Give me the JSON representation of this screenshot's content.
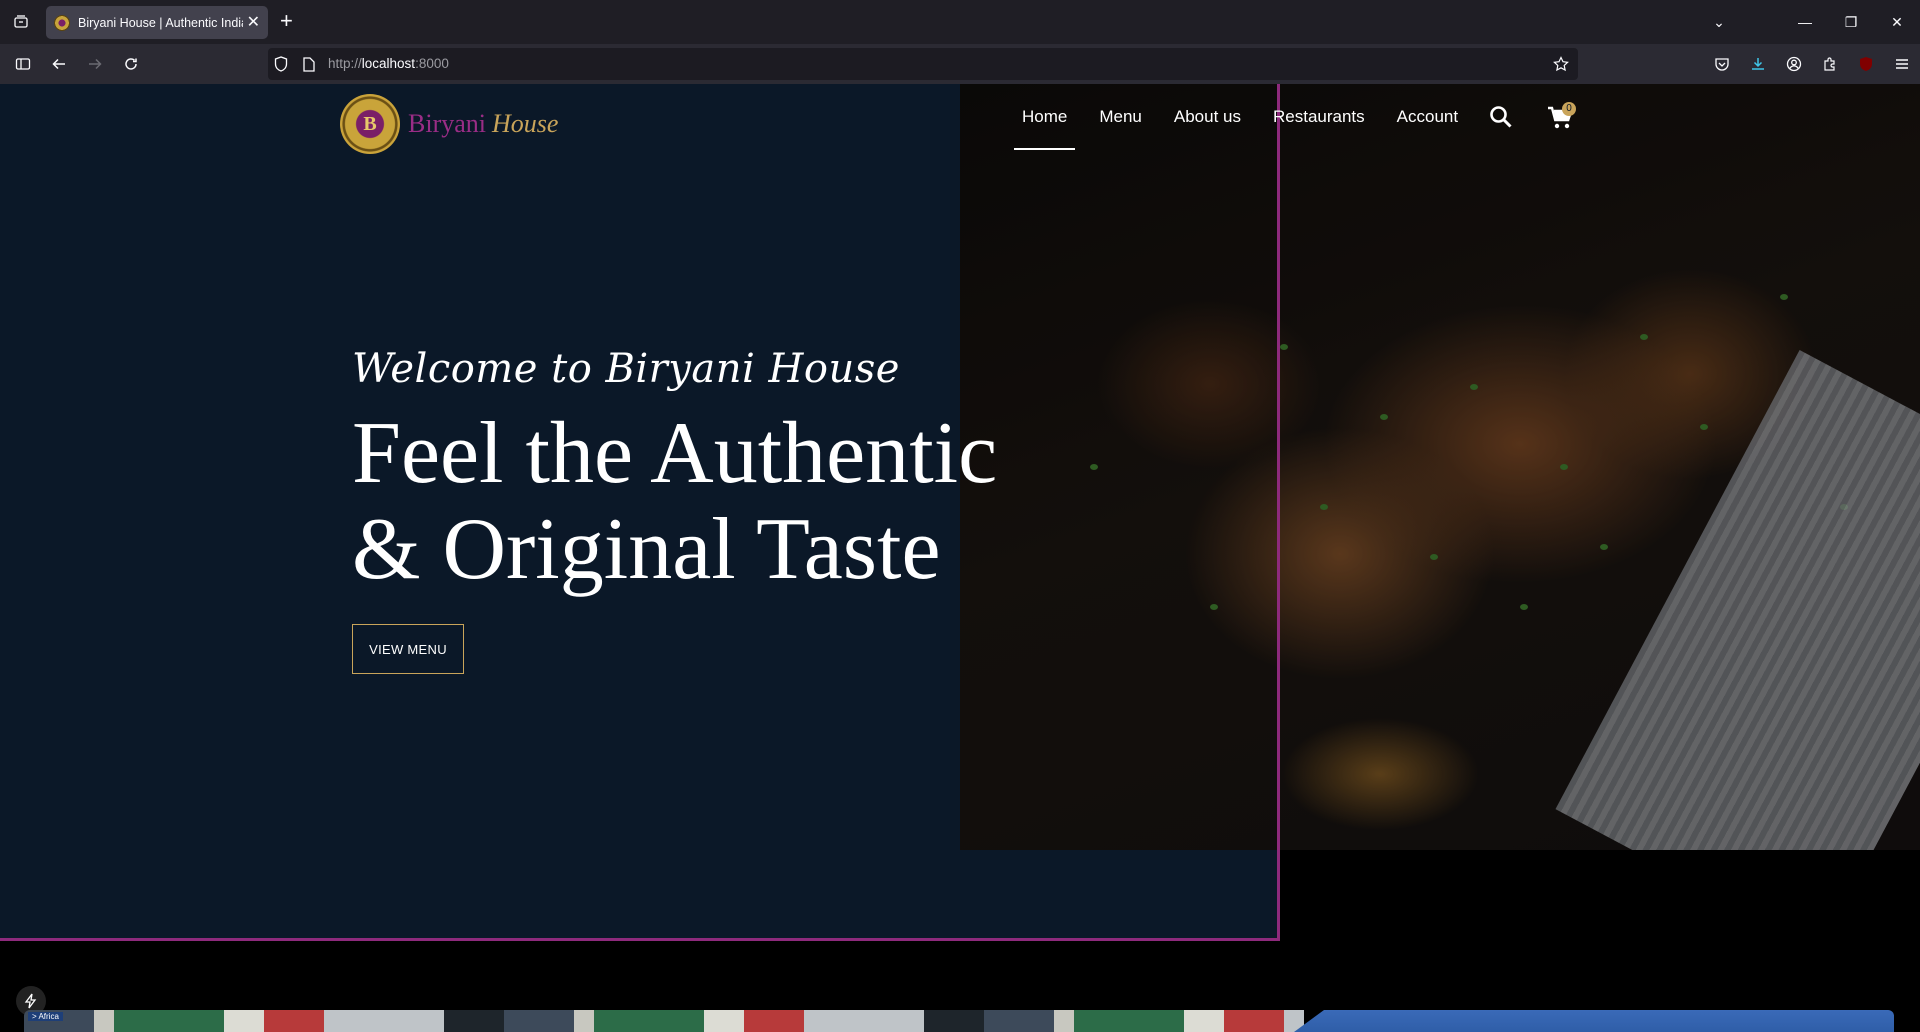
{
  "browser": {
    "tab_title": "Biryani House | Authentic Indian",
    "url_prefix": "http://",
    "url_host": "localhost",
    "url_port": ":8000"
  },
  "site": {
    "logo_word1": "Biryani",
    "logo_word2": "House",
    "logo_emblem_letter": "B",
    "nav": [
      "Home",
      "Menu",
      "About us",
      "Restaurants",
      "Account"
    ],
    "cart_count": "0"
  },
  "hero": {
    "welcome": "Welcome to Biryani House",
    "headline_line1": "Feel the Authentic",
    "headline_line2": "& Original Taste",
    "cta": "VIEW MENU"
  },
  "strip": {
    "sign_text": "> Africa"
  },
  "colors": {
    "hero_bg": "#0b1828",
    "accent_purple": "#8e2a7c",
    "accent_gold": "#c9a45a"
  }
}
